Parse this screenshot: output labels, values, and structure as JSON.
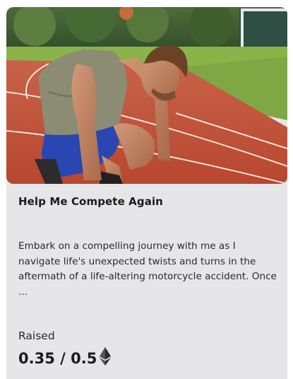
{
  "campaign": {
    "title": "Help Me Compete Again",
    "description": "Embark on a compelling journey with me as I navigate life's unexpected twists and turns in the aftermath of a life-altering motorcycle accident. Once ...",
    "raised_label": "Raised",
    "raised_amount": "0.35 / 0.5",
    "raised_fraction": 0.7,
    "currency_icon": "ethereum-icon",
    "image_description_icon": "athlete-photo"
  },
  "colors": {
    "card_bg": "#e6e6e8",
    "track_red": "#c4553f",
    "grass_green": "#7ca83c",
    "shorts_blue": "#2a46b0"
  }
}
